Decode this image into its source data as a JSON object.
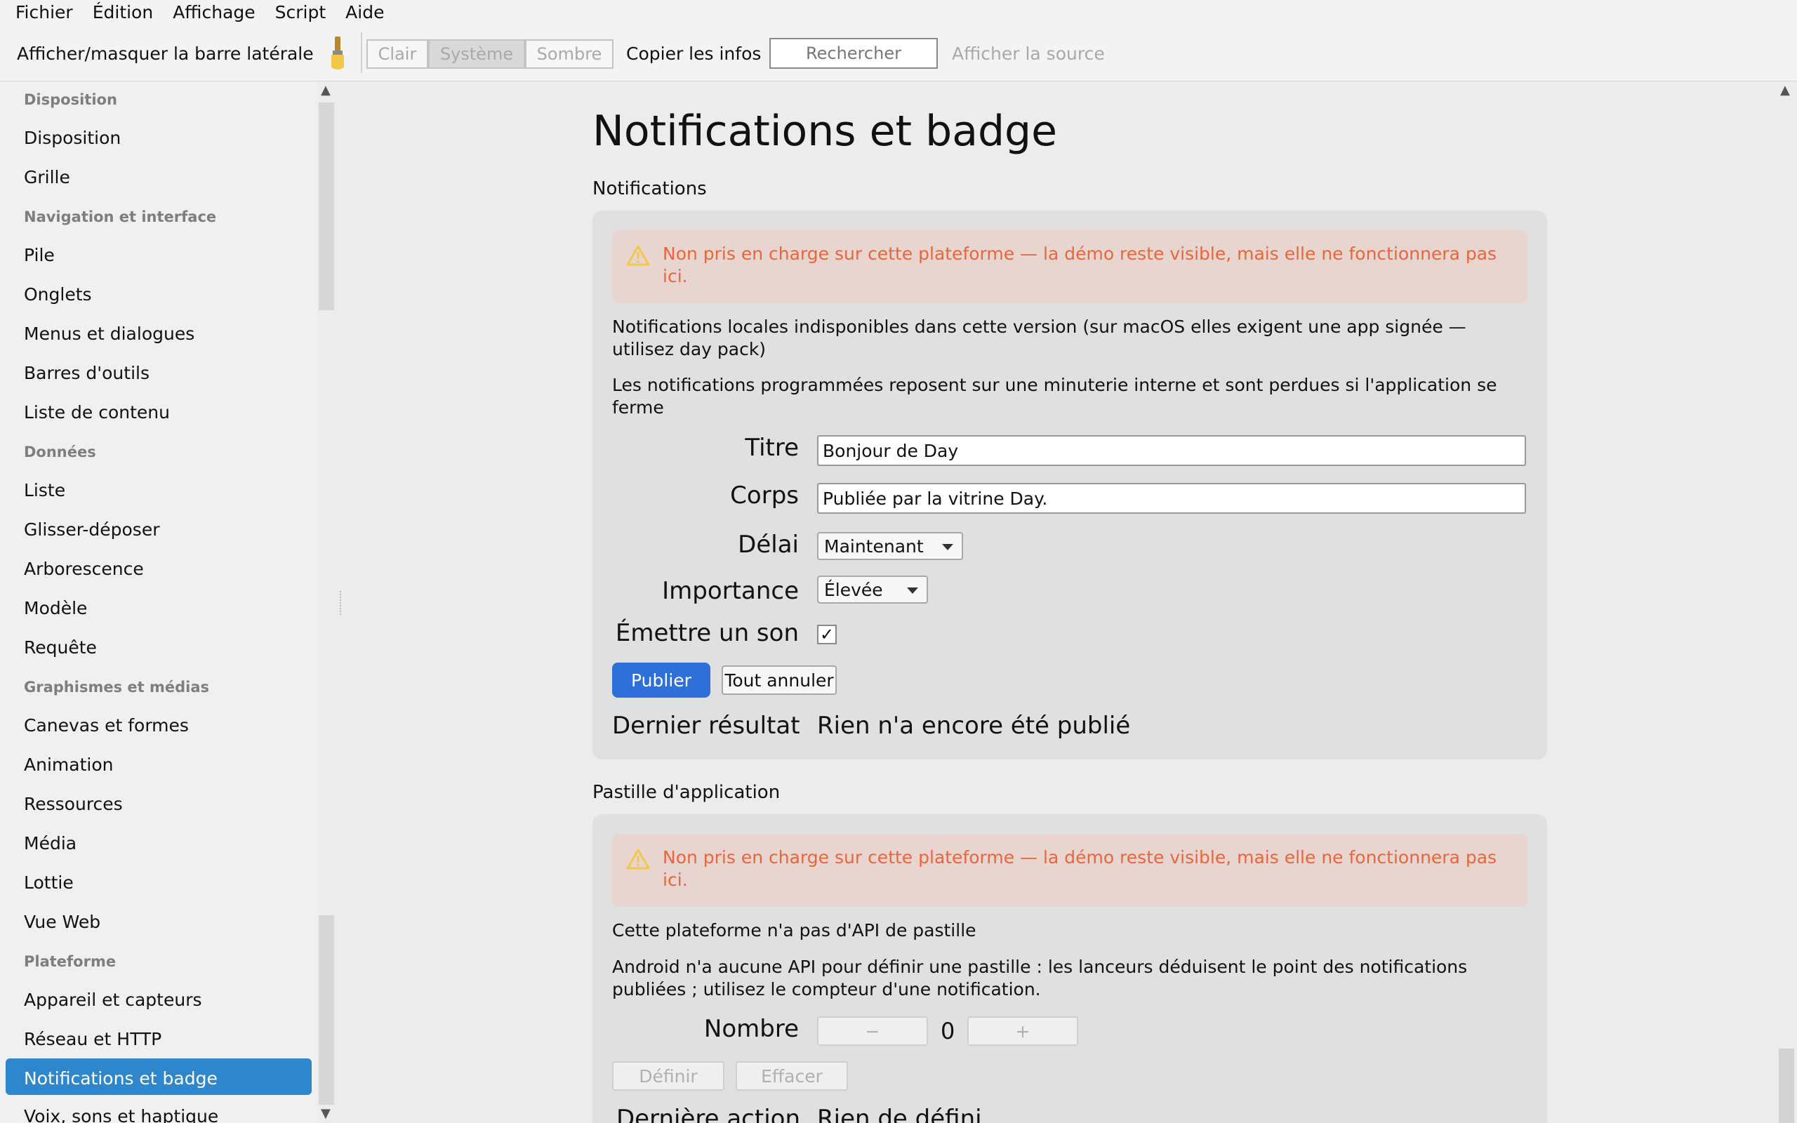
{
  "menu": [
    "Fichier",
    "Édition",
    "Affichage",
    "Script",
    "Aide"
  ],
  "toolbar": {
    "sidebar_toggle": "Afficher/masquer la barre latérale",
    "theme_clair": "Clair",
    "theme_systeme": "Système",
    "theme_sombre": "Sombre",
    "copy_info": "Copier les infos",
    "search_placeholder": "Rechercher",
    "view_source": "Afficher la source"
  },
  "sidebar": {
    "sections": [
      {
        "header": "Disposition",
        "items": [
          "Disposition",
          "Grille"
        ]
      },
      {
        "header": "Navigation et interface",
        "items": [
          "Pile",
          "Onglets",
          "Menus et dialogues",
          "Barres d'outils",
          "Liste de contenu"
        ]
      },
      {
        "header": "Données",
        "items": [
          "Liste",
          "Glisser-déposer",
          "Arborescence",
          "Modèle",
          "Requête"
        ]
      },
      {
        "header": "Graphismes et médias",
        "items": [
          "Canevas et formes",
          "Animation",
          "Ressources",
          "Média",
          "Lottie",
          "Vue Web"
        ]
      },
      {
        "header": "Plateforme",
        "items": [
          "Appareil et capteurs",
          "Réseau et HTTP",
          "Notifications et badge",
          "Voix, sons et haptique"
        ]
      }
    ],
    "selected": "Notifications et badge"
  },
  "main": {
    "title": "Notifications et badge",
    "notifications": {
      "section_title": "Notifications",
      "warning": "Non pris en charge sur cette plateforme — la démo reste visible, mais elle ne fonctionnera pas ici.",
      "note1": "Notifications locales indisponibles dans cette version (sur macOS elles exigent une app signée — utilisez day pack)",
      "note2": "Les notifications programmées reposent sur une minuterie interne et sont perdues si l'application se ferme",
      "titre_label": "Titre",
      "titre_value": "Bonjour de Day",
      "corps_label": "Corps",
      "corps_value": "Publiée par la vitrine Day.",
      "delai_label": "Délai",
      "delai_value": "Maintenant",
      "importance_label": "Importance",
      "importance_value": "Élevée",
      "son_label": "Émettre un son",
      "son_checked": "✓",
      "publish_button": "Publier",
      "cancel_all_button": "Tout annuler",
      "last_result_label": "Dernier résultat",
      "last_result_value": "Rien n'a encore été publié"
    },
    "badge": {
      "section_title": "Pastille d'application",
      "warning": "Non pris en charge sur cette plateforme — la démo reste visible, mais elle ne fonctionnera pas ici.",
      "note1": "Cette plateforme n'a pas d'API de pastille",
      "note2": "Android n'a aucune API pour définir une pastille : les lanceurs déduisent le point des notifications publiées ; utilisez le compteur d'une notification.",
      "count_label": "Nombre",
      "minus": "−",
      "count_value": "0",
      "plus": "+",
      "set_button": "Définir",
      "clear_button": "Effacer",
      "last_action_label": "Dernière action",
      "last_action_value": "Rien de défini"
    }
  },
  "colors": {
    "accent": "#2e87cc",
    "primary_button": "#2e6fd9",
    "warning_text": "#e8663c",
    "warning_bg": "#e9d5cf",
    "warning_icon": "#f2c84b"
  }
}
